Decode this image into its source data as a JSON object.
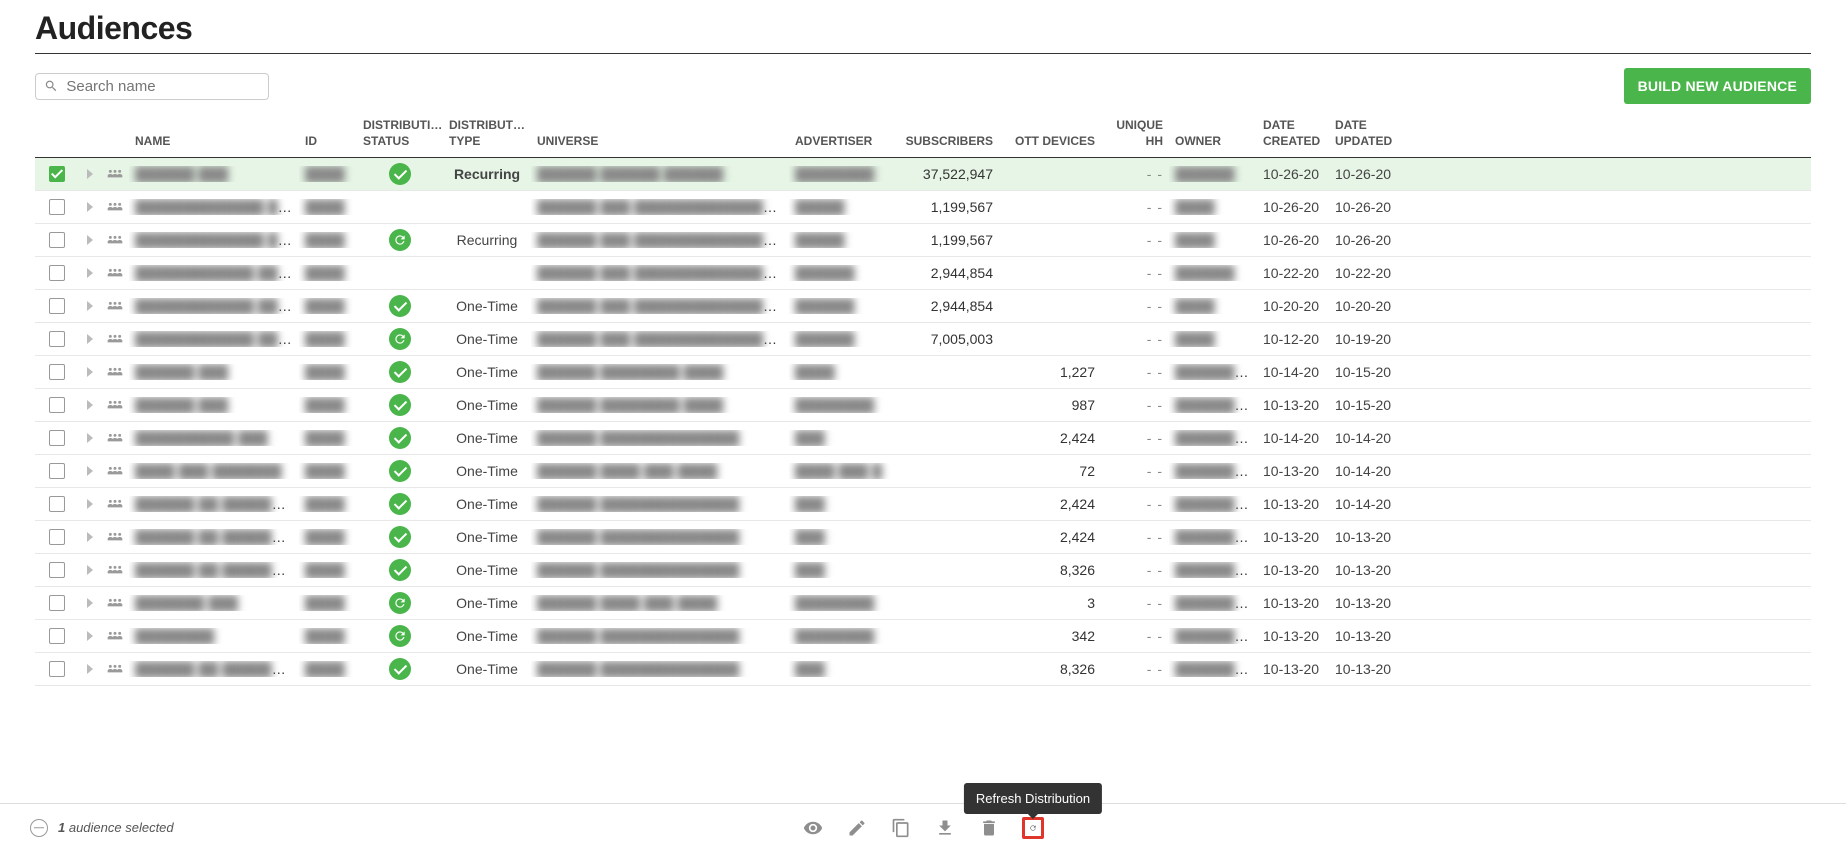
{
  "page_title": "Audiences",
  "search": {
    "placeholder": "Search name"
  },
  "build_button": {
    "label": "BUILD NEW AUDIENCE"
  },
  "columns": {
    "name": "NAME",
    "id": "ID",
    "dist_status": "DISTRIBUTI… STATUS",
    "dist_type": "DISTRIBUTI… TYPE",
    "universe": "UNIVERSE",
    "advertiser": "ADVERTISER",
    "subscribers": "SUBSCRIBERS",
    "ott": "OTT DEVICES",
    "unique_hh": "UNIQUE HH",
    "owner": "OWNER",
    "created": "DATE CREATED",
    "updated": "DATE UPDATED"
  },
  "rows": [
    {
      "selected": true,
      "name": "██████ ███",
      "id": "████",
      "status": "ok",
      "dtype": "Recurring",
      "universe": "██████ ██████ ██████",
      "adv": "████████",
      "subs": "37,522,947",
      "ott": "",
      "hh": "- -",
      "owner": "██████",
      "created": "10-26-20",
      "updated": "10-26-20"
    },
    {
      "selected": false,
      "name": "█████████████ ███████",
      "id": "████",
      "status": "",
      "dtype": "",
      "universe": "██████ ███ ███████████████████",
      "adv": "█████",
      "subs": "1,199,567",
      "ott": "",
      "hh": "- -",
      "owner": "████",
      "created": "10-26-20",
      "updated": "10-26-20"
    },
    {
      "selected": false,
      "name": "█████████████ ███████",
      "id": "████",
      "status": "refresh",
      "dtype": "Recurring",
      "universe": "██████ ███ ███████████████████",
      "adv": "█████",
      "subs": "1,199,567",
      "ott": "",
      "hh": "- -",
      "owner": "████",
      "created": "10-26-20",
      "updated": "10-26-20"
    },
    {
      "selected": false,
      "name": "████████████ ████ ████ ████",
      "id": "████",
      "status": "",
      "dtype": "",
      "universe": "██████ ███ ████████████████ ██████",
      "adv": "██████",
      "subs": "2,944,854",
      "ott": "",
      "hh": "- -",
      "owner": "██████",
      "created": "10-22-20",
      "updated": "10-22-20"
    },
    {
      "selected": false,
      "name": "████████████ ████ ████",
      "id": "████",
      "status": "ok",
      "dtype": "One-Time",
      "universe": "██████ ███ ████████████████ ██████",
      "adv": "██████",
      "subs": "2,944,854",
      "ott": "",
      "hh": "- -",
      "owner": "████",
      "created": "10-20-20",
      "updated": "10-20-20"
    },
    {
      "selected": false,
      "name": "████████████ ████",
      "id": "████",
      "status": "refresh",
      "dtype": "One-Time",
      "universe": "██████ ███ ███████████████████",
      "adv": "██████",
      "subs": "7,005,003",
      "ott": "",
      "hh": "- -",
      "owner": "████",
      "created": "10-12-20",
      "updated": "10-19-20"
    },
    {
      "selected": false,
      "name": "██████ ███",
      "id": "████",
      "status": "ok",
      "dtype": "One-Time",
      "universe": "██████ ████████ ████",
      "adv": "████",
      "subs": "",
      "ott": "1,227",
      "hh": "- -",
      "owner": "████████████",
      "created": "10-14-20",
      "updated": "10-15-20"
    },
    {
      "selected": false,
      "name": "██████ ███",
      "id": "████",
      "status": "ok",
      "dtype": "One-Time",
      "universe": "██████ ████████ ████",
      "adv": "████████",
      "subs": "",
      "ott": "987",
      "hh": "- -",
      "owner": "████████████",
      "created": "10-13-20",
      "updated": "10-15-20"
    },
    {
      "selected": false,
      "name": "██████████ ███",
      "id": "████",
      "status": "ok",
      "dtype": "One-Time",
      "universe": "██████ ██████████████",
      "adv": "███",
      "subs": "",
      "ott": "2,424",
      "hh": "- -",
      "owner": "████████████",
      "created": "10-14-20",
      "updated": "10-14-20"
    },
    {
      "selected": false,
      "name": "████ ███ ███████",
      "id": "████",
      "status": "ok",
      "dtype": "One-Time",
      "universe": "██████ ████ ███ ████",
      "adv": "████ ███ █",
      "subs": "",
      "ott": "72",
      "hh": "- -",
      "owner": "█████████████",
      "created": "10-13-20",
      "updated": "10-14-20"
    },
    {
      "selected": false,
      "name": "██████ ██ ██████ ██ ████ ███",
      "id": "████",
      "status": "ok",
      "dtype": "One-Time",
      "universe": "██████ ██████████████",
      "adv": "███",
      "subs": "",
      "ott": "2,424",
      "hh": "- -",
      "owner": "█████████████",
      "created": "10-13-20",
      "updated": "10-14-20"
    },
    {
      "selected": false,
      "name": "██████ ██ ██████ ██ █████",
      "id": "████",
      "status": "ok",
      "dtype": "One-Time",
      "universe": "██████ ██████████████",
      "adv": "███",
      "subs": "",
      "ott": "2,424",
      "hh": "- -",
      "owner": "█████████████",
      "created": "10-13-20",
      "updated": "10-13-20"
    },
    {
      "selected": false,
      "name": "██████ ██ ██████ ██ ████ ███",
      "id": "████",
      "status": "ok",
      "dtype": "One-Time",
      "universe": "██████ ██████████████",
      "adv": "███",
      "subs": "",
      "ott": "8,326",
      "hh": "- -",
      "owner": "█████████████",
      "created": "10-13-20",
      "updated": "10-13-20"
    },
    {
      "selected": false,
      "name": "███████ ███",
      "id": "████",
      "status": "refresh",
      "dtype": "One-Time",
      "universe": "██████ ████ ███ ████",
      "adv": "████████",
      "subs": "",
      "ott": "3",
      "hh": "- -",
      "owner": "████████████",
      "created": "10-13-20",
      "updated": "10-13-20"
    },
    {
      "selected": false,
      "name": "████████",
      "id": "████",
      "status": "refresh",
      "dtype": "One-Time",
      "universe": "██████ ██████████████",
      "adv": "████████",
      "subs": "",
      "ott": "342",
      "hh": "- -",
      "owner": "████████████",
      "created": "10-13-20",
      "updated": "10-13-20"
    },
    {
      "selected": false,
      "name": "██████ ██ ██████ ██ █████",
      "id": "████",
      "status": "ok",
      "dtype": "One-Time",
      "universe": "██████ ██████████████",
      "adv": "███",
      "subs": "",
      "ott": "8,326",
      "hh": "- -",
      "owner": "█████████████",
      "created": "10-13-20",
      "updated": "10-13-20"
    }
  ],
  "footer": {
    "selected_count": "1",
    "selected_text": " audience selected",
    "tooltip": "Refresh Distribution"
  }
}
